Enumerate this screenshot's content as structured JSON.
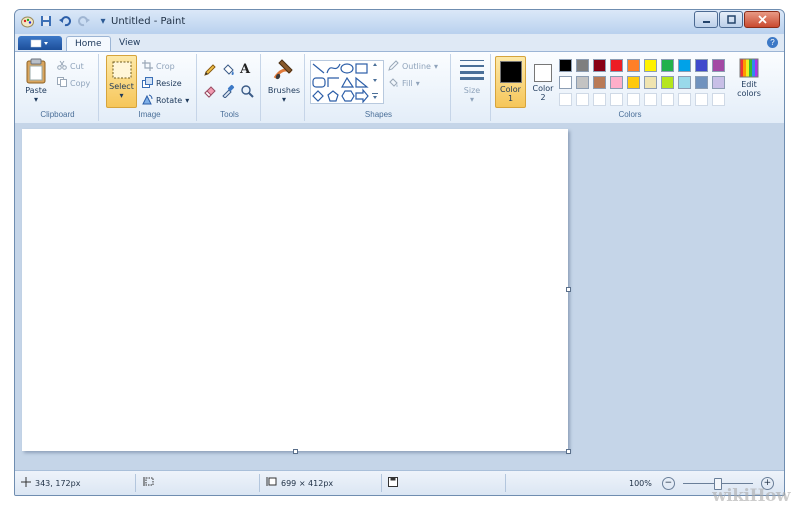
{
  "window": {
    "title": "Untitled - Paint"
  },
  "tabs": {
    "home": "Home",
    "view": "View",
    "help": "?"
  },
  "clipboard": {
    "label": "Clipboard",
    "paste": "Paste",
    "cut": "Cut",
    "copy": "Copy"
  },
  "image": {
    "label": "Image",
    "select": "Select",
    "crop": "Crop",
    "resize": "Resize",
    "rotate": "Rotate"
  },
  "tools": {
    "label": "Tools",
    "text_tool": "A"
  },
  "brushes": {
    "label": "Brushes"
  },
  "shapes": {
    "label": "Shapes",
    "outline": "Outline",
    "fill": "Fill"
  },
  "size": {
    "label": "Size"
  },
  "colors": {
    "label": "Colors",
    "color1": "Color",
    "color1_num": "1",
    "color2": "Color",
    "color2_num": "2",
    "edit": "Edit",
    "edit2": "colors",
    "color1_value": "#000000",
    "color2_value": "#ffffff",
    "palette_row1": [
      "#000000",
      "#7f7f7f",
      "#880015",
      "#ed1c24",
      "#ff7f27",
      "#fff200",
      "#22b14c",
      "#00a2e8",
      "#3f48cc",
      "#a349a4"
    ],
    "palette_row2": [
      "#ffffff",
      "#c3c3c3",
      "#b97a57",
      "#ffaec9",
      "#ffc90e",
      "#efe4b0",
      "#b5e61d",
      "#99d9ea",
      "#7092be",
      "#c8bfe7"
    ]
  },
  "status": {
    "cursor_pos": "343, 172px",
    "canvas_size": "699 × 412px",
    "zoom": "100%",
    "zoom_out": "−",
    "zoom_in": "+"
  },
  "watermark": "wikiHow"
}
